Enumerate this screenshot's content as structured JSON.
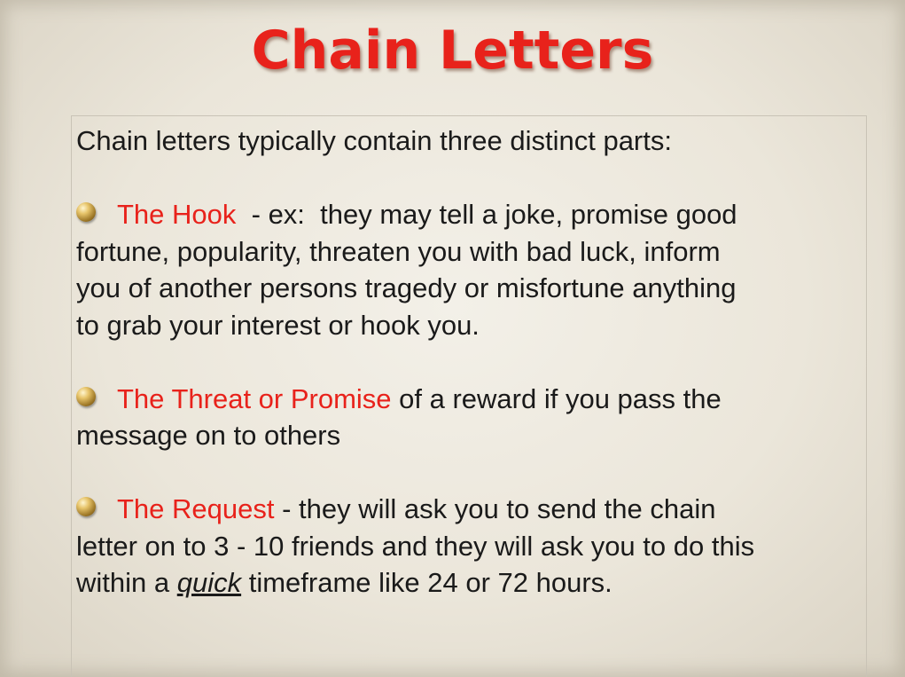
{
  "title": "Chain Letters",
  "intro": "Chain letters typically contain three distinct parts:",
  "bullets": [
    {
      "icon": "gold-ball-icon",
      "label": "The Hook",
      "text_before_break": "  - ex:  they may tell a joke, promise good",
      "lines": [
        "fortune, popularity, threaten you with bad luck, inform",
        "you of another persons tragedy or misfortune anything",
        "to grab your interest or hook you."
      ]
    },
    {
      "icon": "gold-ball-icon",
      "label": "The Threat or Promise",
      "text_before_break": " of a reward if you pass the",
      "lines": [
        "message on to others"
      ]
    },
    {
      "icon": "gold-ball-icon",
      "label": "The Request",
      "text_before_break": " - they will ask you to send the chain",
      "lines": [
        "letter on to 3 - 10 friends and they will ask you to do this"
      ],
      "last_line_prefix": "within a ",
      "last_line_emphasis": "quick",
      "last_line_suffix": " timeframe like 24 or 72 hours."
    }
  ],
  "colors": {
    "title": "#e8221b",
    "highlight": "#e8221b",
    "text": "#1a1a1a",
    "background": "#ebe6da"
  }
}
